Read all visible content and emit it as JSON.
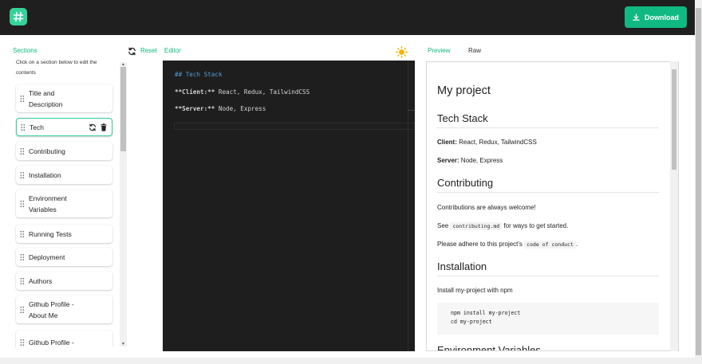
{
  "header": {
    "logo_icon": "hash-icon",
    "download_label": "Download",
    "download_icon": "download-icon",
    "accent": "#10b981"
  },
  "sections_panel": {
    "title": "Sections",
    "subtitle": "Click on a section below to edit the contents",
    "items": [
      {
        "label": "Title and\nDescription",
        "active": false
      },
      {
        "label": "Tech",
        "active": true
      },
      {
        "label": "Contributing",
        "active": false
      },
      {
        "label": "Installation",
        "active": false
      },
      {
        "label": "Environment\nVariables",
        "active": false
      },
      {
        "label": "Running Tests",
        "active": false
      },
      {
        "label": "Deployment",
        "active": false
      },
      {
        "label": "Authors",
        "active": false
      },
      {
        "label": "Github Profile -\nAbout Me",
        "active": false
      },
      {
        "label": "Github Profile -",
        "active": false
      }
    ]
  },
  "editor": {
    "reset_label": "Reset",
    "title": "Editor",
    "theme_icon": "sun-icon",
    "lines": [
      {
        "prefix": "## Tech Stack",
        "rest": ""
      },
      {
        "prefix": "**Client:**",
        "rest": " React, Redux, TailwindCSS"
      },
      {
        "prefix": "**Server:**",
        "rest": " Node, Express"
      }
    ]
  },
  "preview": {
    "tab_preview": "Preview",
    "tab_raw": "Raw",
    "h1": "My project",
    "tech_heading": "Tech Stack",
    "client_label": "Client:",
    "client_value": " React, Redux, TailwindCSS",
    "server_label": "Server:",
    "server_value": " Node, Express",
    "contributing_heading": "Contributing",
    "contrib_p1": "Contributions are always welcome!",
    "contrib_see": "See ",
    "contrib_code": "contributing.md",
    "contrib_after": " for ways to get started.",
    "adhere_before": "Please adhere to this project's ",
    "adhere_code": "code of conduct",
    "adhere_after": ".",
    "installation_heading": "Installation",
    "install_p": "Install my-project with npm",
    "install_code": "npm install my-project\ncd my-project",
    "next_heading": "Environment Variables"
  }
}
